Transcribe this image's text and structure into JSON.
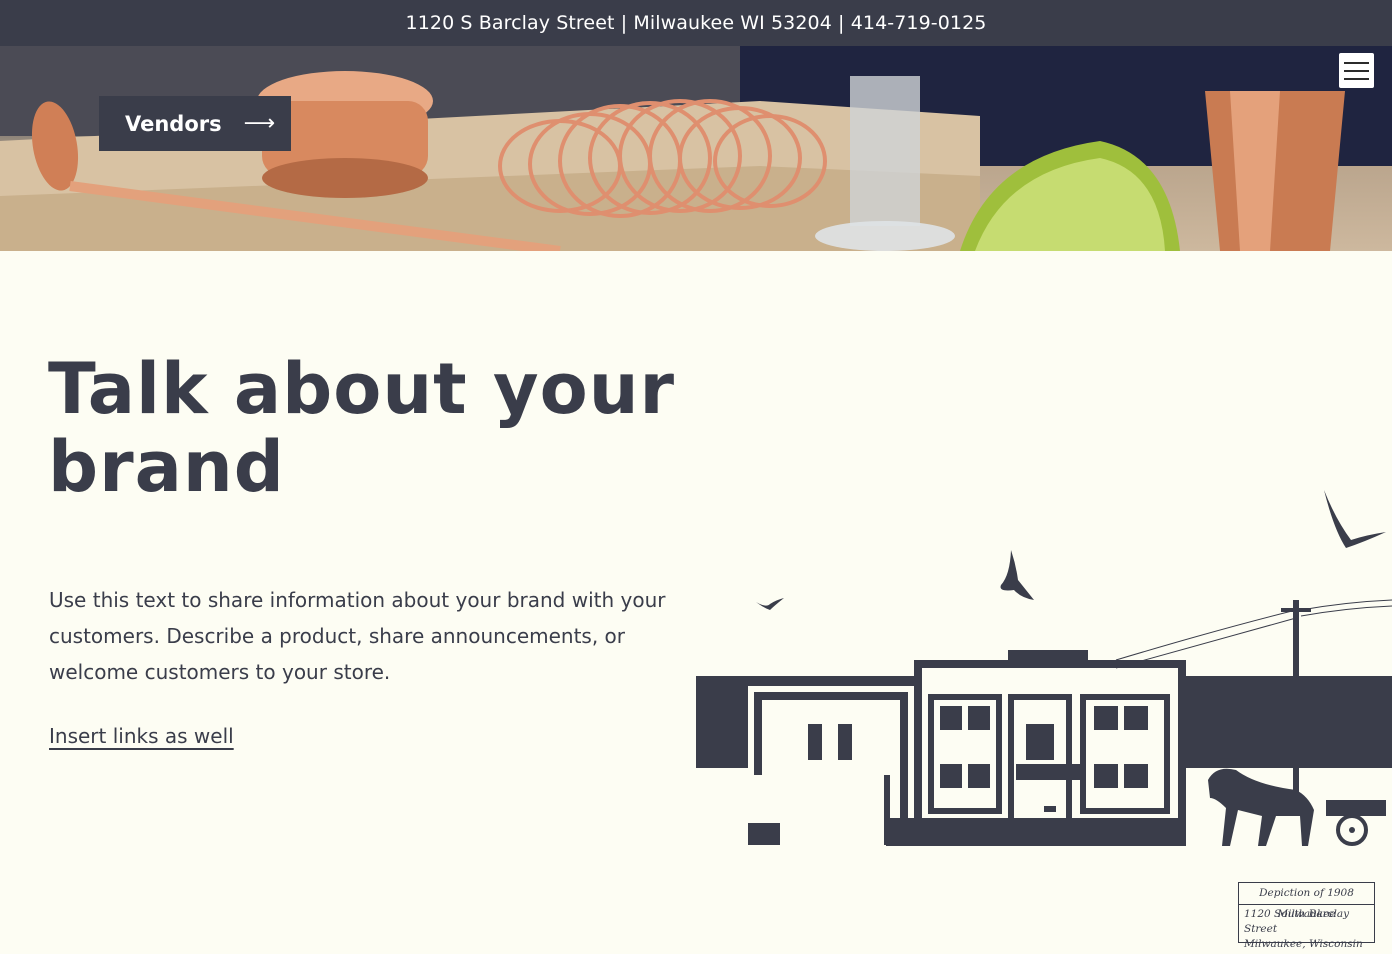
{
  "topbar": {
    "address": "1120 S Barclay Street | Milwaukee WI 53204 | 414-719-0125"
  },
  "hero": {
    "vendors_label": "Vendors",
    "arrow_glyph": "⟶",
    "menu_icon": "hamburger-menu-icon"
  },
  "main": {
    "heading_line1": "Talk about your",
    "heading_line2": "brand",
    "body": "Use this text to share information about your brand with your customers. Describe a product, share announcements, or welcome customers to your store.",
    "link": "Insert links as well"
  },
  "caption": {
    "title": "Depiction of 1908 Milwaukee",
    "line1": "1120 South Barclay Street",
    "line2": "Milwaukee, Wisconsin"
  },
  "colors": {
    "dark": "#3a3d4a",
    "background": "#fdfdf3",
    "copper": "#d98e6a"
  }
}
